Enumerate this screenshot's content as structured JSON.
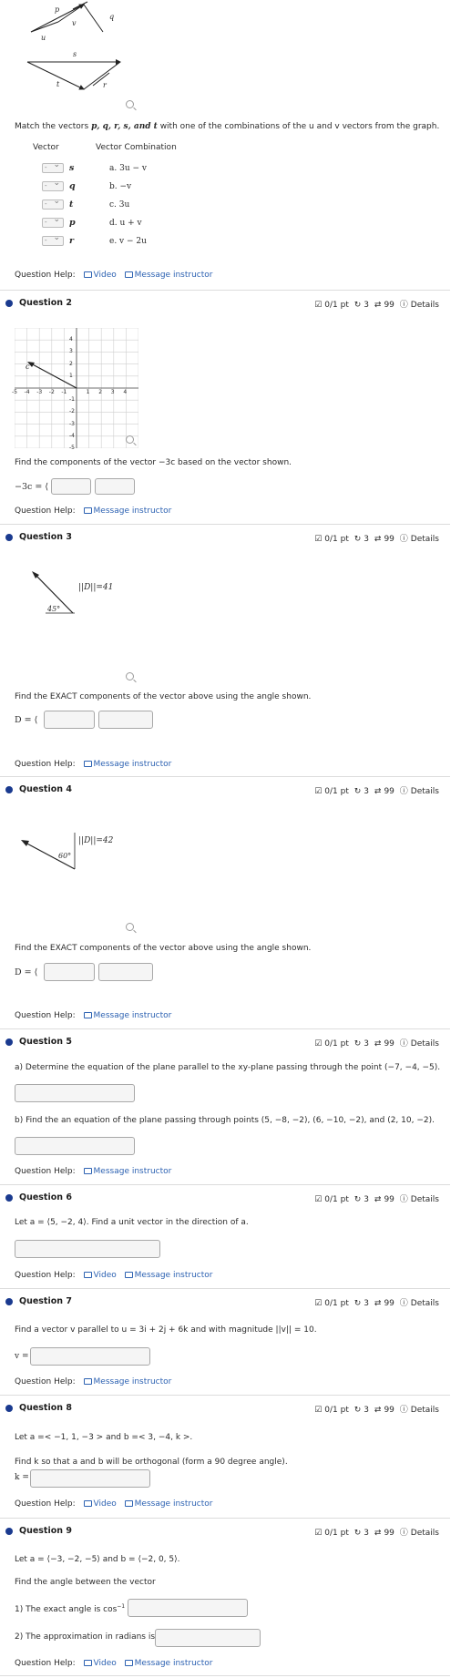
{
  "q1": {
    "figure_labels": {
      "p": "p",
      "q": "q",
      "v": "v",
      "u": "u",
      "s": "s",
      "t": "t",
      "r": "r"
    },
    "prompt_pre": "Match the vectors ",
    "prompt_vectors": "p, q, r, s, and  t",
    "prompt_post": " with one of the combinations of the u and v vectors from the graph.",
    "col_vector": "Vector",
    "col_combo": "Vector Combination",
    "rows": [
      {
        "select": "-",
        "vector": "s",
        "combo": "a. 3u − v"
      },
      {
        "select": "-",
        "vector": "q",
        "combo": "b. −v"
      },
      {
        "select": "-",
        "vector": "t",
        "combo": "c. 3u"
      },
      {
        "select": "-",
        "vector": "p",
        "combo": "d. u + v"
      },
      {
        "select": "-",
        "vector": "r",
        "combo": "e. v − 2u"
      }
    ],
    "help_label": "Question Help:",
    "video": "Video",
    "message": "Message instructor"
  },
  "questions": [
    {
      "title": "Question 2",
      "score": "0/1 pt",
      "retries": "3",
      "attempts": "99",
      "details": "Details"
    },
    {
      "title": "Question 3",
      "score": "0/1 pt",
      "retries": "3",
      "attempts": "99",
      "details": "Details"
    },
    {
      "title": "Question 4",
      "score": "0/1 pt",
      "retries": "3",
      "attempts": "99",
      "details": "Details"
    },
    {
      "title": "Question 5",
      "score": "0/1 pt",
      "retries": "3",
      "attempts": "99",
      "details": "Details"
    },
    {
      "title": "Question 6",
      "score": "0/1 pt",
      "retries": "3",
      "attempts": "99",
      "details": "Details"
    },
    {
      "title": "Question 7",
      "score": "0/1 pt",
      "retries": "3",
      "attempts": "99",
      "details": "Details"
    },
    {
      "title": "Question 8",
      "score": "0/1 pt",
      "retries": "3",
      "attempts": "99",
      "details": "Details"
    },
    {
      "title": "Question 9",
      "score": "0/1 pt",
      "retries": "3",
      "attempts": "99",
      "details": "Details"
    }
  ],
  "q2": {
    "vector_label": "c",
    "y_ticks": [
      "4",
      "3",
      "2",
      "1",
      "-1",
      "-2",
      "-3",
      "-4",
      "-5"
    ],
    "x_ticks": [
      "-5",
      "-4",
      "-3",
      "-2",
      "-1",
      "1",
      "2",
      "3",
      "4"
    ],
    "prompt": "Find the components of the vector −3c based on the vector shown.",
    "answer_label": "−3c = ⟨",
    "help_label": "Question Help:",
    "message": "Message instructor"
  },
  "q3": {
    "magnitude": "||D||=41",
    "angle": "45°",
    "prompt": "Find the EXACT components of the vector above using the angle shown.",
    "answer_label": "D = ⟨",
    "help_label": "Question Help:",
    "message": "Message instructor"
  },
  "q4": {
    "magnitude": "||D||=42",
    "angle": "60°",
    "prompt": "Find the EXACT components of the vector above using the angle shown.",
    "answer_label": "D = ⟨",
    "help_label": "Question Help:",
    "message": "Message instructor"
  },
  "q5": {
    "part_a": "a) Determine the equation of the plane parallel to the xy-plane passing through the point (−7, −4, −5).",
    "part_b": "b) Find the an equation of the plane passing through points (5, −8, −2), (6, −10, −2), and (2, 10, −2).",
    "help_label": "Question Help:",
    "message": "Message instructor"
  },
  "q6": {
    "prompt": "Let a = ⟨5, −2, 4⟩. Find a unit vector in the direction of a.",
    "help_label": "Question Help:",
    "video": "Video",
    "message": "Message instructor"
  },
  "q7": {
    "prompt": "Find a vector v parallel to u = 3i + 2j + 6k and with magnitude ||v|| = 10.",
    "answer_label": "v =",
    "help_label": "Question Help:",
    "message": "Message instructor"
  },
  "q8": {
    "prompt1": "Let a =< −1, 1, −3 > and b =< 3, −4, k >.",
    "prompt2": "Find k so that a and b will be orthogonal (form a 90 degree angle).",
    "answer_label": "k =",
    "help_label": "Question Help:",
    "video": "Video",
    "message": "Message instructor"
  },
  "q9": {
    "prompt1": "Let a = ⟨−3, −2, −5⟩ and b = ⟨−2, 0, 5⟩.",
    "prompt2": "Find the angle between the vector",
    "part1": "1) The exact angle is cos",
    "part1_sup": "−1",
    "part2": "2) The approximation in radians is",
    "help_label": "Question Help:",
    "video": "Video",
    "message": "Message instructor"
  }
}
